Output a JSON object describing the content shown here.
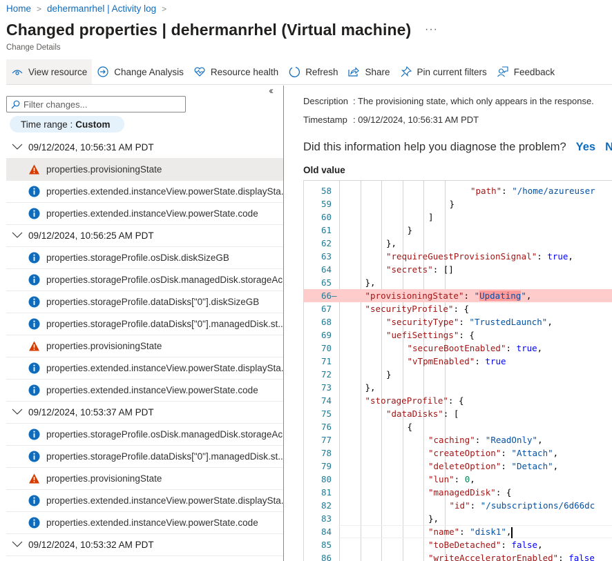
{
  "breadcrumb": [
    {
      "label": "Home"
    },
    {
      "label": "dehermanrhel | Activity log"
    }
  ],
  "page": {
    "title": "Changed properties | dehermanrhel (Virtual machine)",
    "subtitle": "Change Details",
    "more": "···"
  },
  "toolbar": {
    "view_resource": "View resource",
    "change_analysis": "Change Analysis",
    "resource_health": "Resource health",
    "refresh": "Refresh",
    "share": "Share",
    "pin_filters": "Pin current filters",
    "feedback": "Feedback"
  },
  "left": {
    "collapse": "«",
    "filter_placeholder": "Filter changes...",
    "time_range_label": "Time range :",
    "time_range_value": "Custom",
    "groups": [
      {
        "timestamp": "09/12/2024, 10:56:31 AM PDT",
        "items": [
          {
            "severity": "warning",
            "label": "properties.provisioningState",
            "selected": true
          },
          {
            "severity": "info",
            "label": "properties.extended.instanceView.powerState.displaySta..."
          },
          {
            "severity": "info",
            "label": "properties.extended.instanceView.powerState.code"
          }
        ]
      },
      {
        "timestamp": "09/12/2024, 10:56:25 AM PDT",
        "items": [
          {
            "severity": "info",
            "label": "properties.storageProfile.osDisk.diskSizeGB"
          },
          {
            "severity": "info",
            "label": "properties.storageProfile.osDisk.managedDisk.storageAc..."
          },
          {
            "severity": "info",
            "label": "properties.storageProfile.dataDisks[\"0\"].diskSizeGB"
          },
          {
            "severity": "info",
            "label": "properties.storageProfile.dataDisks[\"0\"].managedDisk.st..."
          },
          {
            "severity": "warning",
            "label": "properties.provisioningState"
          },
          {
            "severity": "info",
            "label": "properties.extended.instanceView.powerState.displaySta..."
          },
          {
            "severity": "info",
            "label": "properties.extended.instanceView.powerState.code"
          }
        ]
      },
      {
        "timestamp": "09/12/2024, 10:53:37 AM PDT",
        "items": [
          {
            "severity": "info",
            "label": "properties.storageProfile.osDisk.managedDisk.storageAc..."
          },
          {
            "severity": "info",
            "label": "properties.storageProfile.dataDisks[\"0\"].managedDisk.st..."
          },
          {
            "severity": "warning",
            "label": "properties.provisioningState"
          },
          {
            "severity": "info",
            "label": "properties.extended.instanceView.powerState.displaySta..."
          },
          {
            "severity": "info",
            "label": "properties.extended.instanceView.powerState.code"
          }
        ]
      },
      {
        "timestamp": "09/12/2024, 10:53:32 AM PDT",
        "items": []
      }
    ]
  },
  "details": {
    "description_label": "Description",
    "description": ": The provisioning state, which only appears in the response.",
    "timestamp_label": "Timestamp",
    "timestamp": ": 09/12/2024, 10:56:31 AM PDT",
    "question": "Did this information help you diagnose the problem?",
    "yes": "Yes",
    "no": "N",
    "old_value_label": "Old value"
  },
  "colors": {
    "accent": "#0f6cbd",
    "warning": "#d83b01",
    "info": "#0f6cbd",
    "removed_line": "#ffcccc"
  },
  "code": {
    "lines": [
      {
        "n": "58",
        "indent": 7,
        "tokens": [
          [
            "k",
            "\"path\""
          ],
          [
            "p",
            ": "
          ],
          [
            "s",
            "\"/home/azureuser"
          ]
        ]
      },
      {
        "n": "59",
        "indent": 6,
        "tokens": [
          [
            "p",
            "}"
          ]
        ]
      },
      {
        "n": "60",
        "indent": 5,
        "tokens": [
          [
            "p",
            "]"
          ]
        ]
      },
      {
        "n": "61",
        "indent": 4,
        "tokens": [
          [
            "p",
            "}"
          ]
        ]
      },
      {
        "n": "62",
        "indent": 3,
        "tokens": [
          [
            "p",
            "},"
          ]
        ]
      },
      {
        "n": "63",
        "indent": 3,
        "tokens": [
          [
            "k",
            "\"requireGuestProvisionSignal\""
          ],
          [
            "p",
            ": "
          ],
          [
            "b",
            "true"
          ],
          [
            "p",
            ","
          ]
        ]
      },
      {
        "n": "64",
        "indent": 3,
        "tokens": [
          [
            "k",
            "\"secrets\""
          ],
          [
            "p",
            ": []"
          ]
        ]
      },
      {
        "n": "65",
        "indent": 2,
        "tokens": [
          [
            "p",
            "},"
          ]
        ]
      },
      {
        "n": "66",
        "indent": 2,
        "removed": true,
        "tokens": [
          [
            "k",
            "\"provisioningState\""
          ],
          [
            "p",
            ": "
          ],
          [
            "s",
            "\""
          ],
          [
            "h",
            "Updating"
          ],
          [
            "s",
            "\""
          ],
          [
            "p",
            ","
          ]
        ]
      },
      {
        "n": "67",
        "indent": 2,
        "tokens": [
          [
            "k",
            "\"securityProfile\""
          ],
          [
            "p",
            ": {"
          ]
        ]
      },
      {
        "n": "68",
        "indent": 3,
        "tokens": [
          [
            "k",
            "\"securityType\""
          ],
          [
            "p",
            ": "
          ],
          [
            "s",
            "\"TrustedLaunch\""
          ],
          [
            "p",
            ","
          ]
        ]
      },
      {
        "n": "69",
        "indent": 3,
        "tokens": [
          [
            "k",
            "\"uefiSettings\""
          ],
          [
            "p",
            ": {"
          ]
        ]
      },
      {
        "n": "70",
        "indent": 4,
        "tokens": [
          [
            "k",
            "\"secureBootEnabled\""
          ],
          [
            "p",
            ": "
          ],
          [
            "b",
            "true"
          ],
          [
            "p",
            ","
          ]
        ]
      },
      {
        "n": "71",
        "indent": 4,
        "tokens": [
          [
            "k",
            "\"vTpmEnabled\""
          ],
          [
            "p",
            ": "
          ],
          [
            "b",
            "true"
          ]
        ]
      },
      {
        "n": "72",
        "indent": 3,
        "tokens": [
          [
            "p",
            "}"
          ]
        ]
      },
      {
        "n": "73",
        "indent": 2,
        "tokens": [
          [
            "p",
            "},"
          ]
        ]
      },
      {
        "n": "74",
        "indent": 2,
        "tokens": [
          [
            "k",
            "\"storageProfile\""
          ],
          [
            "p",
            ": {"
          ]
        ]
      },
      {
        "n": "75",
        "indent": 3,
        "tokens": [
          [
            "k",
            "\"dataDisks\""
          ],
          [
            "p",
            ": ["
          ]
        ]
      },
      {
        "n": "76",
        "indent": 4,
        "tokens": [
          [
            "p",
            "{"
          ]
        ]
      },
      {
        "n": "77",
        "indent": 5,
        "tokens": [
          [
            "k",
            "\"caching\""
          ],
          [
            "p",
            ": "
          ],
          [
            "s",
            "\"ReadOnly\""
          ],
          [
            "p",
            ","
          ]
        ]
      },
      {
        "n": "78",
        "indent": 5,
        "tokens": [
          [
            "k",
            "\"createOption\""
          ],
          [
            "p",
            ": "
          ],
          [
            "s",
            "\"Attach\""
          ],
          [
            "p",
            ","
          ]
        ]
      },
      {
        "n": "79",
        "indent": 5,
        "tokens": [
          [
            "k",
            "\"deleteOption\""
          ],
          [
            "p",
            ": "
          ],
          [
            "s",
            "\"Detach\""
          ],
          [
            "p",
            ","
          ]
        ]
      },
      {
        "n": "80",
        "indent": 5,
        "tokens": [
          [
            "k",
            "\"lun\""
          ],
          [
            "p",
            ": "
          ],
          [
            "n",
            "0"
          ],
          [
            "p",
            ","
          ]
        ]
      },
      {
        "n": "81",
        "indent": 5,
        "tokens": [
          [
            "k",
            "\"managedDisk\""
          ],
          [
            "p",
            ": {"
          ]
        ]
      },
      {
        "n": "82",
        "indent": 6,
        "tokens": [
          [
            "k",
            "\"id\""
          ],
          [
            "p",
            ": "
          ],
          [
            "s",
            "\"/subscriptions/6d66dc"
          ]
        ]
      },
      {
        "n": "83",
        "indent": 5,
        "tokens": [
          [
            "p",
            "},"
          ]
        ]
      },
      {
        "n": "84",
        "indent": 5,
        "current": true,
        "tokens": [
          [
            "k",
            "\"name\""
          ],
          [
            "p",
            ": "
          ],
          [
            "s",
            "\"disk1\""
          ],
          [
            "p",
            ","
          ],
          [
            "c",
            ""
          ]
        ]
      },
      {
        "n": "85",
        "indent": 5,
        "tokens": [
          [
            "k",
            "\"toBeDetached\""
          ],
          [
            "p",
            ": "
          ],
          [
            "b",
            "false"
          ],
          [
            "p",
            ","
          ]
        ]
      },
      {
        "n": "86",
        "indent": 5,
        "tokens": [
          [
            "k",
            "\"writeAcceleratorEnabled\""
          ],
          [
            "p",
            ": "
          ],
          [
            "b",
            "false"
          ]
        ]
      }
    ]
  }
}
